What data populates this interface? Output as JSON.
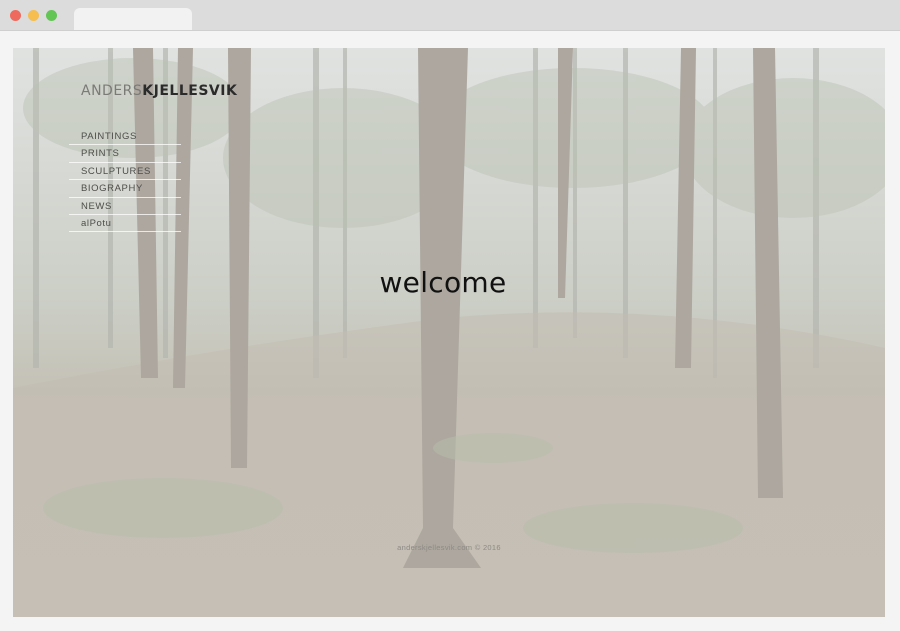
{
  "site": {
    "logo_first": "ANDERS",
    "logo_last": "KJELLESVIK",
    "welcome": "welcome",
    "footer": "anderskjellesvik.com © 2016"
  },
  "nav": {
    "items": [
      {
        "label": "PAINTINGS"
      },
      {
        "label": "PRINTS"
      },
      {
        "label": "SCULPTURES"
      },
      {
        "label": "BIOGRAPHY"
      },
      {
        "label": "NEWS"
      },
      {
        "label": "alPotu"
      }
    ]
  },
  "colors": {
    "titlebar": "#dcdcdc",
    "close_dot": "#ee6a5f",
    "minimize_dot": "#f5be4f",
    "zoom_dot": "#62c554",
    "background_wash": "#f5f3ef",
    "text": "#111111"
  }
}
